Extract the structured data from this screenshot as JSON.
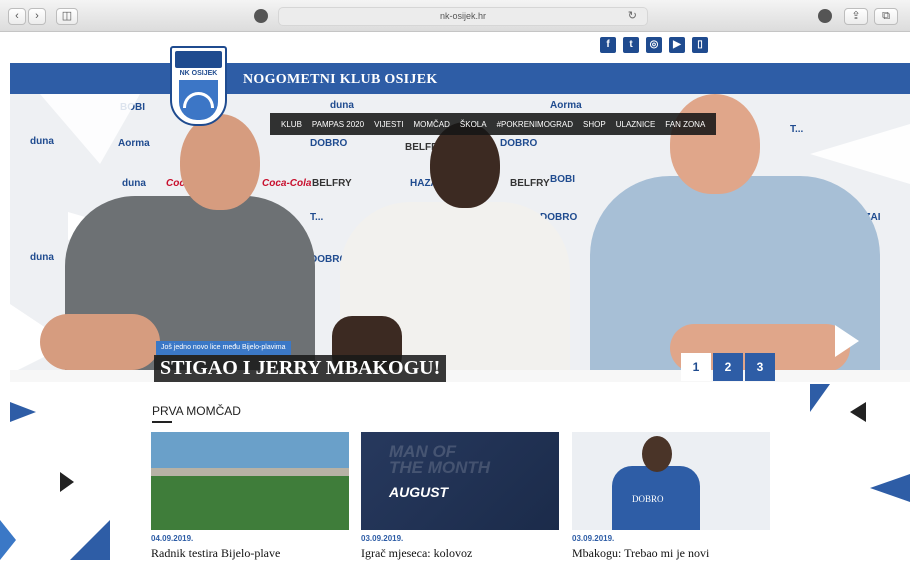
{
  "browser": {
    "url": "nk-osijek.hr",
    "back_label": "‹",
    "forward_label": "›",
    "sidebar_label": "◫",
    "reload_label": "↻",
    "share_label": "⇪",
    "tabs_label": "⧉"
  },
  "social": [
    {
      "icon": "facebook-icon",
      "glyph": "f"
    },
    {
      "icon": "twitter-icon",
      "glyph": "t"
    },
    {
      "icon": "instagram-icon",
      "glyph": "◎"
    },
    {
      "icon": "youtube-icon",
      "glyph": "▶"
    },
    {
      "icon": "document-icon",
      "glyph": "▯"
    }
  ],
  "header": {
    "club_name": "NOGOMETNI KLUB OSIJEK",
    "crest_text": "NK OSIJEK"
  },
  "menu": [
    "KLUB",
    "PAMPAS 2020",
    "VIJESTI",
    "MOMČAD",
    "ŠKOLA",
    "#POKRENIMOGRAD",
    "SHOP",
    "ULAZNICE",
    "FAN ZONA"
  ],
  "hero": {
    "kicker": "Još jedno novo lice među Bijelo-plavima",
    "headline": "STIGAO I JERRY MBAKOGU!",
    "pages": [
      "1",
      "2",
      "3"
    ],
    "active_page": "1",
    "sponsors": [
      "BOBI",
      "duna",
      "Aorma",
      "DOBRO",
      "BELFRY",
      "HAZAI",
      "Coca-Cola",
      "T..."
    ]
  },
  "news": {
    "section_title": "PRVA MOMČAD",
    "items": [
      {
        "date": "04.09.2019.",
        "title": "Radnik testira Bijelo-plave"
      },
      {
        "date": "03.09.2019.",
        "title": "Igrač mjeseca: kolovoz",
        "thumb_line1": "MAN OF",
        "thumb_line2": "THE MONTH",
        "thumb_month": "AUGUST"
      },
      {
        "date": "03.09.2019.",
        "title": "Mbakogu: Trebao mi je novi",
        "thumb_text": "DOBRO"
      }
    ]
  },
  "colors": {
    "brand_blue": "#2e5da6",
    "dark_blue": "#1f4b8f",
    "accent_light": "#3b78c6"
  }
}
